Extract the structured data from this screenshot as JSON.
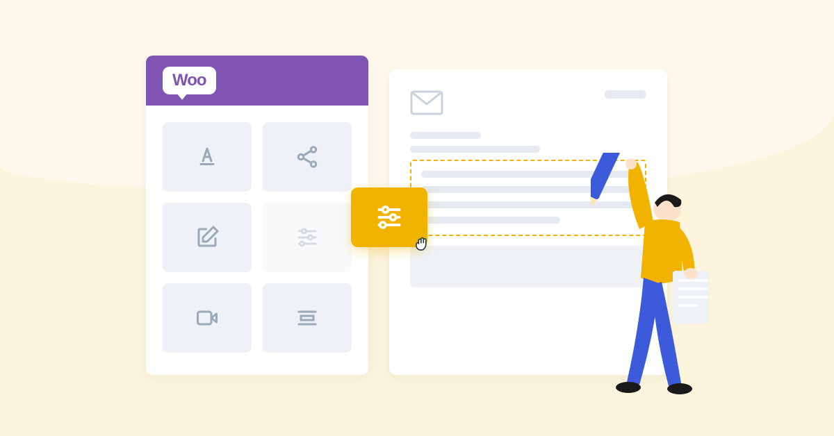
{
  "woo": {
    "logo_text": "Woo"
  },
  "builder": {
    "tools": [
      {
        "name": "text-icon"
      },
      {
        "name": "share-icon"
      },
      {
        "name": "edit-icon"
      },
      {
        "name": "sliders-icon"
      },
      {
        "name": "video-icon"
      },
      {
        "name": "layout-icon"
      }
    ]
  },
  "email": {
    "provider_icon": "gmail-icon"
  },
  "dragged_tool": {
    "name": "sliders-icon"
  },
  "colors": {
    "woo_purple": "#7F54B3",
    "accent_yellow": "#F2B200",
    "bg_cream": "#FDF4DD",
    "person_shirt": "#F2B200",
    "person_pants": "#3B5BDB"
  }
}
